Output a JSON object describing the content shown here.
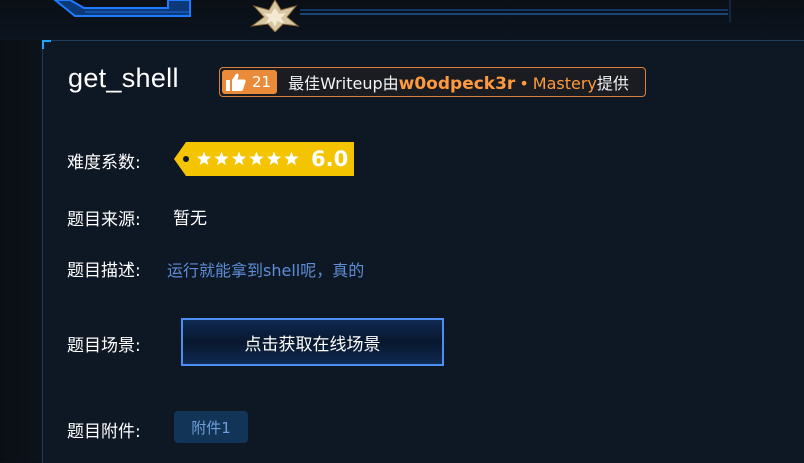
{
  "challenge": {
    "title": "get_shell"
  },
  "writeup": {
    "likes": "21",
    "prefix": "最佳Writeup由",
    "author": "w0odpeck3r",
    "separator": "•",
    "rank": "Mastery",
    "suffix": "提供"
  },
  "rows": {
    "difficulty_label": "难度系数:",
    "difficulty_value": "6.0",
    "difficulty_stars": 6,
    "source_label": "题目来源:",
    "source_value": "暂无",
    "desc_label": "题目描述:",
    "desc_value": "运行就能拿到shell呢，真的",
    "scene_label": "题目场景:",
    "scene_button": "点击获取在线场景",
    "attach_label": "题目附件:",
    "attach_button": "附件1"
  },
  "colors": {
    "accent_orange": "#e98b38",
    "difficulty_yellow": "#f5c400",
    "scene_border": "#4d8ef0",
    "desc_text": "#5d8ed6"
  }
}
